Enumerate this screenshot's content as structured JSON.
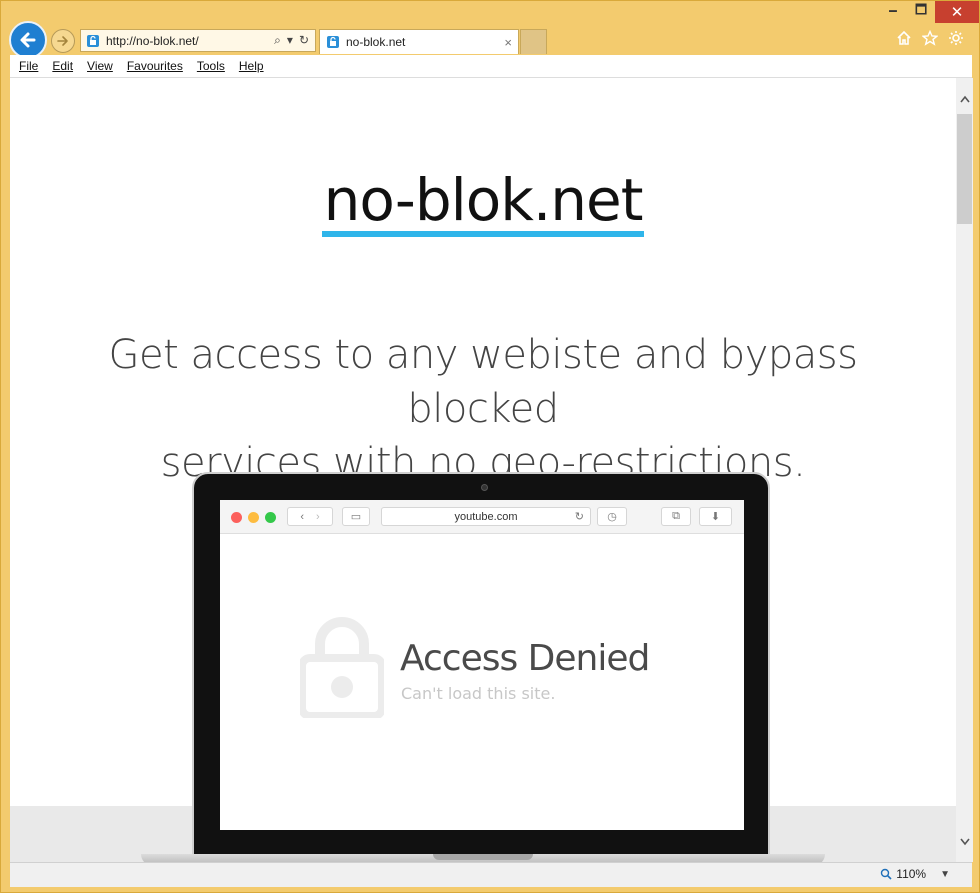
{
  "window": {
    "minimize": "🗕",
    "maximize": "🗖",
    "close": "✕"
  },
  "address_bar": {
    "url": "http://no-blok.net/",
    "search_glyph": "⌕",
    "dropdown_glyph": "▾",
    "refresh_glyph": "↻"
  },
  "tab": {
    "title": "no-blok.net",
    "close_glyph": "×"
  },
  "menu": {
    "file": "File",
    "edit": "Edit",
    "view": "View",
    "favourites": "Favourites",
    "tools": "Tools",
    "help": "Help"
  },
  "page": {
    "site_title": "no-blok.net",
    "tagline_line1": "Get access to any webiste and bypass blocked",
    "tagline_line2": "services with no geo-restrictions.",
    "accent_color": "#2fb5ea"
  },
  "mockup": {
    "url": "youtube.com",
    "denied_title": "Access Denied",
    "denied_subtitle": "Can't load this site."
  },
  "status": {
    "zoom": "110%"
  }
}
